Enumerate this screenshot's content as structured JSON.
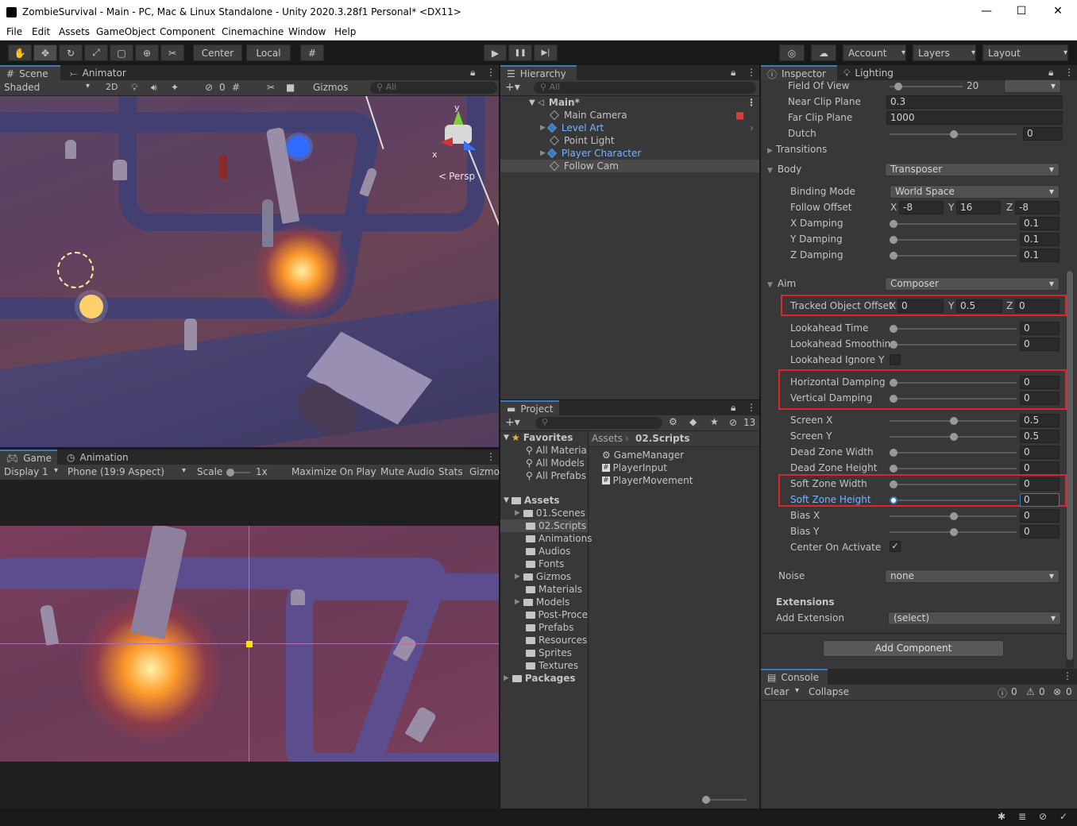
{
  "window": {
    "title": "ZombieSurvival - Main - PC, Mac & Linux Standalone - Unity 2020.3.28f1 Personal* <DX11>",
    "minimize": "—",
    "maximize": "☐",
    "close": "✕"
  },
  "menu": [
    "File",
    "Edit",
    "Assets",
    "GameObject",
    "Component",
    "Cinemachine",
    "Window",
    "Help"
  ],
  "toolbar": {
    "center_label": "Center",
    "local_label": "Local",
    "account_label": "Account",
    "layers_label": "Layers",
    "layout_label": "Layout",
    "play_icon": "▶",
    "pause_icon": "❚❚",
    "step_icon": "▶|"
  },
  "scene": {
    "tab_scene": "Scene",
    "tab_animator": "Animator",
    "shading": "Shaded",
    "mode_2d": "2D",
    "hidden_count": "0",
    "gizmos": "Gizmos",
    "search_placeholder": "All",
    "persp": "Persp",
    "axis_x": "x",
    "axis_y": "y"
  },
  "game": {
    "tab_game": "Game",
    "tab_animation": "Animation",
    "display": "Display 1",
    "aspect": "Phone (19:9 Aspect)",
    "scale_label": "Scale",
    "scale_value": "1x",
    "maximize": "Maximize On Play",
    "mute": "Mute Audio",
    "stats": "Stats",
    "gizmos": "Gizmo"
  },
  "hierarchy": {
    "tab": "Hierarchy",
    "search_placeholder": "All",
    "scene_name": "Main*",
    "items": [
      "Main Camera",
      "Level Art",
      "Point Light",
      "Player Character",
      "Follow Cam"
    ]
  },
  "project": {
    "tab": "Project",
    "hidden_count": "13",
    "favorites_label": "Favorites",
    "favorites": [
      "All Materia",
      "All Models",
      "All Prefabs"
    ],
    "assets_label": "Assets",
    "folders": [
      "01.Scenes",
      "02.Scripts",
      "Animations",
      "Audios",
      "Fonts",
      "Gizmos",
      "Materials",
      "Models",
      "Post-Proce",
      "Prefabs",
      "Resources",
      "Sprites",
      "Textures"
    ],
    "packages_label": "Packages",
    "breadcrumb_root": "Assets",
    "breadcrumb_current": "02.Scripts",
    "files": [
      "GameManager",
      "PlayerInput",
      "PlayerMovement"
    ]
  },
  "inspector": {
    "tab_inspector": "Inspector",
    "tab_lighting": "Lighting",
    "field_of_view": {
      "label": "Field Of View",
      "value": "20"
    },
    "near_clip": {
      "label": "Near Clip Plane",
      "value": "0.3"
    },
    "far_clip": {
      "label": "Far Clip Plane",
      "value": "1000"
    },
    "dutch": {
      "label": "Dutch",
      "value": "0"
    },
    "transitions": "Transitions",
    "body": {
      "label": "Body",
      "value": "Transposer"
    },
    "binding_mode": {
      "label": "Binding Mode",
      "value": "World Space"
    },
    "follow_offset": {
      "label": "Follow Offset",
      "x": "-8",
      "y": "16",
      "z": "-8"
    },
    "x_damping": {
      "label": "X Damping",
      "value": "0.1"
    },
    "y_damping": {
      "label": "Y Damping",
      "value": "0.1"
    },
    "z_damping": {
      "label": "Z Damping",
      "value": "0.1"
    },
    "aim": {
      "label": "Aim",
      "value": "Composer"
    },
    "tracked_offset": {
      "label": "Tracked Object Offset",
      "x": "0",
      "y": "0.5",
      "z": "0"
    },
    "lookahead_time": {
      "label": "Lookahead Time",
      "value": "0"
    },
    "lookahead_smoothing": {
      "label": "Lookahead Smoothing",
      "value": "0"
    },
    "lookahead_ignore_y": {
      "label": "Lookahead Ignore Y"
    },
    "horizontal_damping": {
      "label": "Horizontal Damping",
      "value": "0"
    },
    "vertical_damping": {
      "label": "Vertical Damping",
      "value": "0"
    },
    "screen_x": {
      "label": "Screen X",
      "value": "0.5"
    },
    "screen_y": {
      "label": "Screen Y",
      "value": "0.5"
    },
    "dead_zone_width": {
      "label": "Dead Zone Width",
      "value": "0"
    },
    "dead_zone_height": {
      "label": "Dead Zone Height",
      "value": "0"
    },
    "soft_zone_width": {
      "label": "Soft Zone Width",
      "value": "0"
    },
    "soft_zone_height": {
      "label": "Soft Zone Height",
      "value": "0"
    },
    "bias_x": {
      "label": "Bias X",
      "value": "0"
    },
    "bias_y": {
      "label": "Bias Y",
      "value": "0"
    },
    "center_on_activate": {
      "label": "Center On Activate",
      "check": "✓"
    },
    "noise": {
      "label": "Noise",
      "value": "none"
    },
    "extensions": "Extensions",
    "add_extension": {
      "label": "Add Extension",
      "value": "(select)"
    },
    "add_component": "Add Component",
    "axis": {
      "x": "X",
      "y": "Y",
      "z": "Z"
    }
  },
  "console": {
    "tab": "Console",
    "clear": "Clear",
    "collapse": "Collapse",
    "info": "0",
    "warn": "0",
    "error": "0"
  },
  "colors": {
    "accent": "#3a79bb",
    "highlight_box": "#e0252b",
    "panel": "#383838",
    "toolbar": "#191919"
  }
}
